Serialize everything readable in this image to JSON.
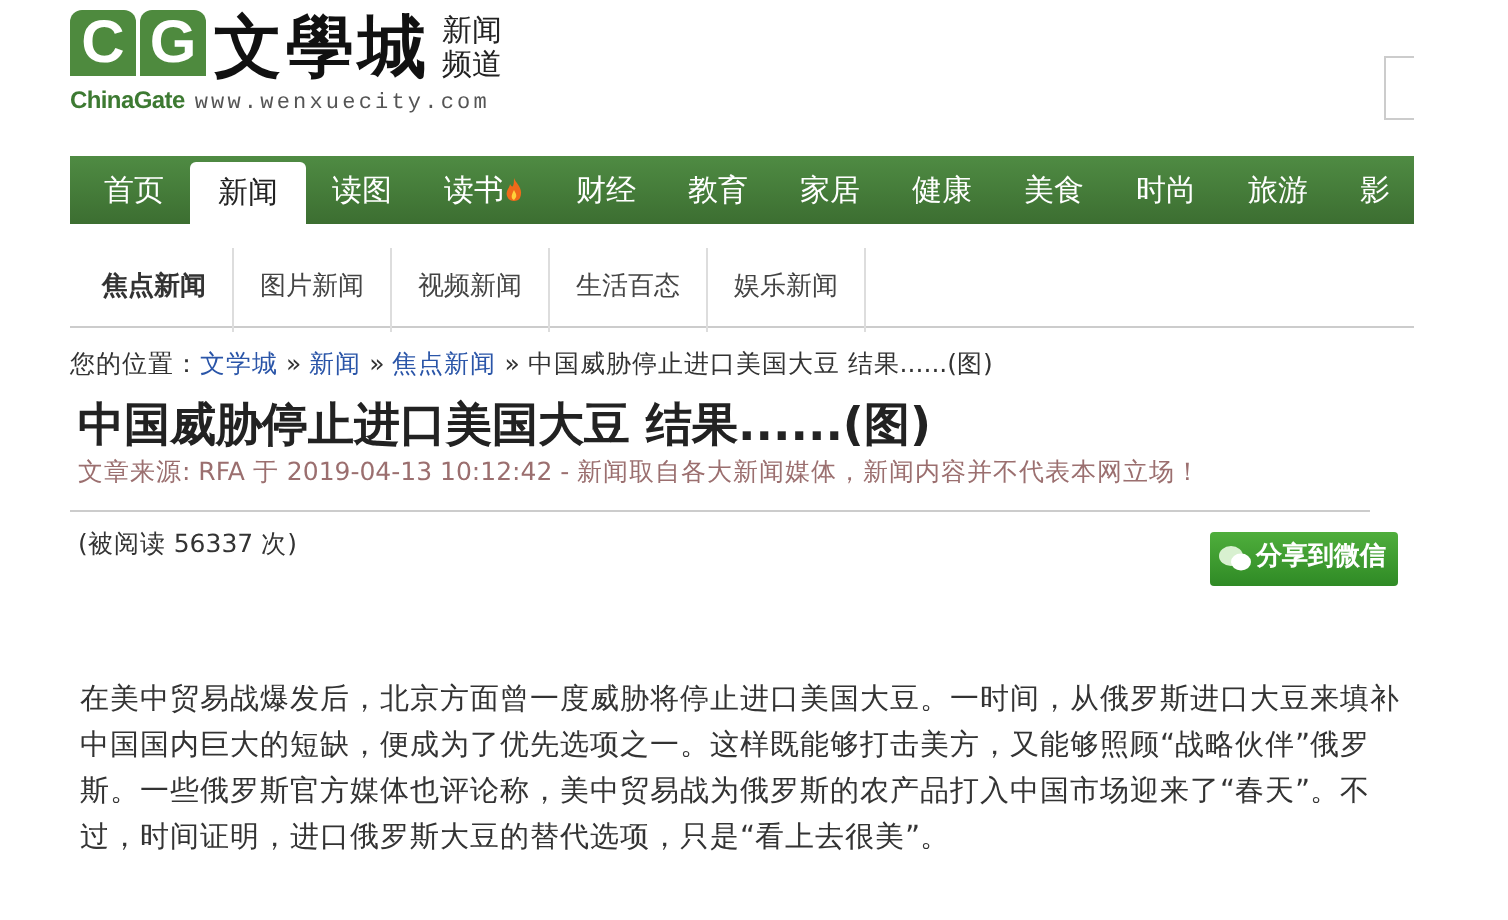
{
  "logo": {
    "letters": [
      "C",
      "G"
    ],
    "name": "文學城",
    "channel": [
      "新闻",
      "频道"
    ],
    "brand": "ChinaGate",
    "url": "www.wenxuecity.com"
  },
  "nav": [
    {
      "label": "首页",
      "selected": false
    },
    {
      "label": "新闻",
      "selected": true
    },
    {
      "label": "读图",
      "selected": false
    },
    {
      "label": "读书",
      "selected": false,
      "hot": true
    },
    {
      "label": "财经",
      "selected": false
    },
    {
      "label": "教育",
      "selected": false
    },
    {
      "label": "家居",
      "selected": false
    },
    {
      "label": "健康",
      "selected": false
    },
    {
      "label": "美食",
      "selected": false
    },
    {
      "label": "时尚",
      "selected": false
    },
    {
      "label": "旅游",
      "selected": false
    },
    {
      "label": "影",
      "selected": false
    }
  ],
  "subnav": [
    {
      "label": "焦点新闻",
      "selected": true
    },
    {
      "label": "图片新闻",
      "selected": false
    },
    {
      "label": "视频新闻",
      "selected": false
    },
    {
      "label": "生活百态",
      "selected": false
    },
    {
      "label": "娱乐新闻",
      "selected": false
    }
  ],
  "breadcrumb": {
    "prefix": "您的位置：",
    "links": [
      "文学城",
      "新闻",
      "焦点新闻"
    ],
    "current": "中国威胁停止进口美国大豆 结果......(图)",
    "separator": "»"
  },
  "article": {
    "title": "中国威胁停止进口美国大豆 结果......(图)",
    "meta": "文章来源: RFA 于 2019-04-13 10:12:42 - 新闻取自各大新闻媒体，新闻内容并不代表本网立场！",
    "views": "(被阅读 56337 次)",
    "share": "分享到微信",
    "body": "在美中贸易战爆发后，北京方面曾一度威胁将停止进口美国大豆。一时间，从俄罗斯进口大豆来填补中国国内巨大的短缺，便成为了优先选项之一。这样既能够打击美方，又能够照顾“战略伙伴”俄罗斯。一些俄罗斯官方媒体也评论称，美中贸易战为俄罗斯的农产品打入中国市场迎来了“春天”。不过，时间证明，进口俄罗斯大豆的替代选项，只是“看上去很美”。"
  }
}
